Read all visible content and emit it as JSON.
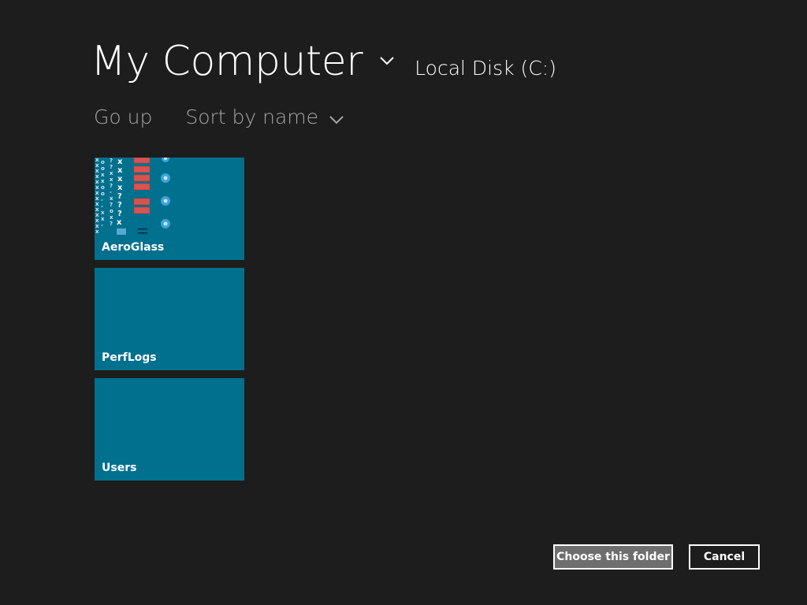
{
  "header": {
    "location_title": "My Computer",
    "current_folder": "Local Disk (C:)"
  },
  "commands": {
    "go_up": "Go up",
    "sort": "Sort by name"
  },
  "folders": [
    {
      "name": "AeroGlass",
      "has_thumbnail": true
    },
    {
      "name": "PerfLogs",
      "has_thumbnail": false
    },
    {
      "name": "Users",
      "has_thumbnail": false
    }
  ],
  "buttons": {
    "choose": "Choose this folder",
    "cancel": "Cancel"
  },
  "icons": {
    "location_dropdown": "chevron-down-icon",
    "sort_dropdown": "chevron-down-icon"
  },
  "colors": {
    "background": "#1d1d1d",
    "tile": "#00708f",
    "secondary_text": "#a6a6a6",
    "primary_button": "#6e6e6e"
  }
}
